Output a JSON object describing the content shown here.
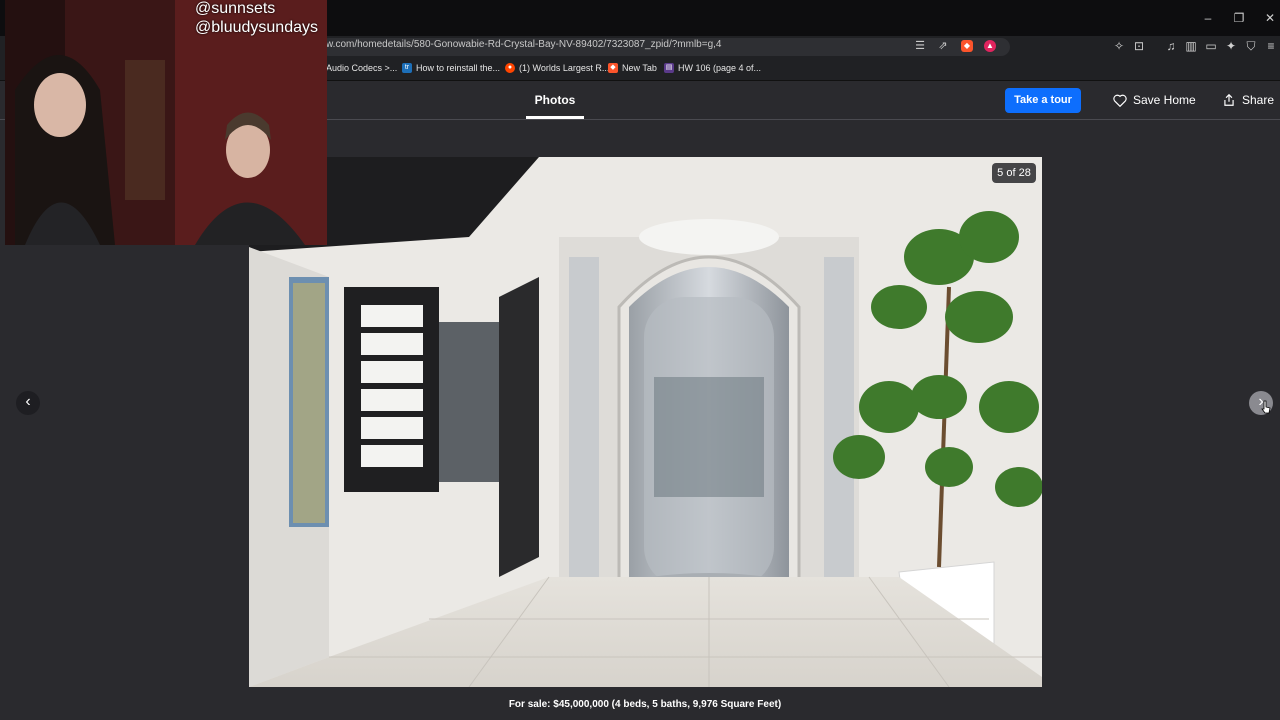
{
  "browser": {
    "url": "w.com/homedetails/580-Gonowabie-Rd-Crystal-Bay-NV-89402/7323087_zpid/?mmlb=g,4",
    "bookmarks": [
      {
        "label": "Audio Codecs >..."
      },
      {
        "label": "How to reinstall the..."
      },
      {
        "label": "(1) Worlds Largest R..."
      },
      {
        "label": "New Tab"
      },
      {
        "label": "HW 106 (page 4 of..."
      }
    ],
    "window_controls": {
      "minimize": "–",
      "restore": "❐",
      "close": "✕"
    }
  },
  "header": {
    "tab_photos": "Photos",
    "take_tour": "Take a tour",
    "save_home": "Save Home",
    "share": "Share"
  },
  "viewer": {
    "counter": "5 of 28",
    "caption": "For sale: $45,000,000 (4 beds, 5 baths, 9,976 Square Feet)",
    "prev_icon": "chevron-left-icon",
    "next_icon": "chevron-right-icon"
  },
  "webcam": {
    "handle_1": "@sunnsets",
    "handle_2": "@bluudysundays"
  },
  "colors": {
    "accent": "#0d6efd",
    "page_bg": "#2a2a2e"
  }
}
